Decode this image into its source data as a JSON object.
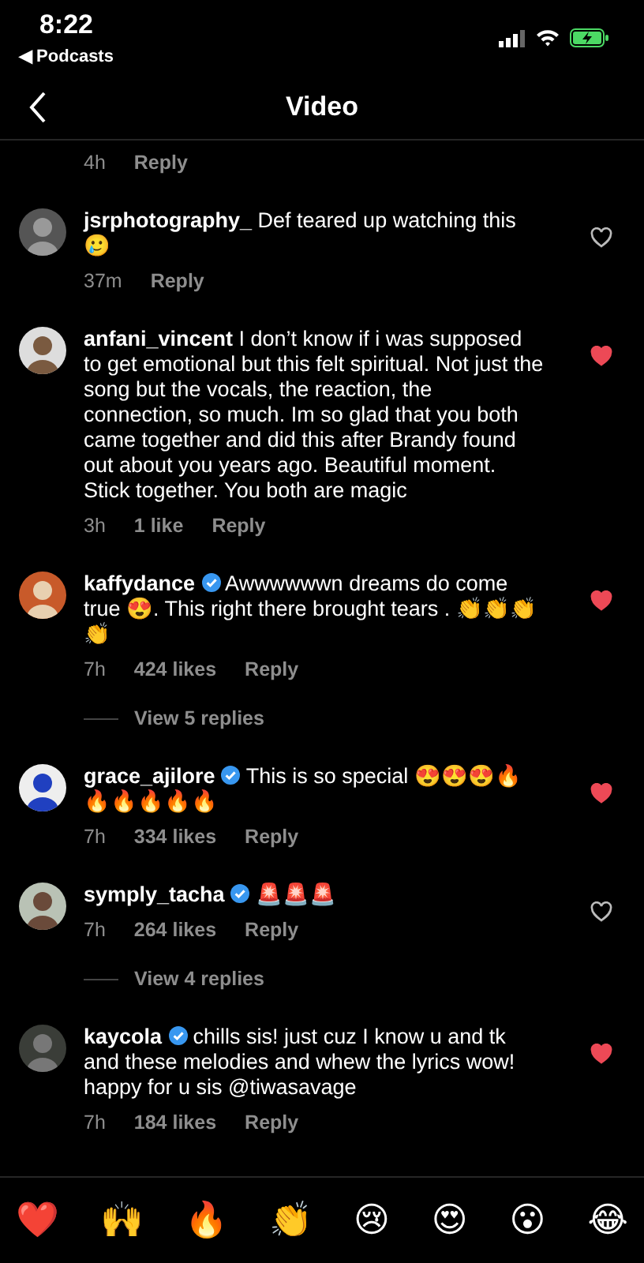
{
  "status_bar": {
    "time": "8:22",
    "back_app": "◀ Podcasts"
  },
  "nav": {
    "title": "Video"
  },
  "previous_comment": {
    "time": "4h",
    "reply": "Reply"
  },
  "comments": [
    {
      "user": "jsrphotography_",
      "verified": false,
      "text": "Def teared up watching this 🥲",
      "time": "37m",
      "reply": "Reply",
      "liked": false
    },
    {
      "user": "anfani_vincent",
      "verified": false,
      "text": "I don’t know if i was supposed to get emotional but this felt spiritual. Not just the song but the vocals, the reaction, the connection, so much. Im so glad that you both came together and did this after Brandy found out about you years ago. Beautiful moment. Stick together. You both are magic",
      "time": "3h",
      "likes": "1 like",
      "reply": "Reply",
      "liked": true
    },
    {
      "user": "kaffydance",
      "verified": true,
      "text": "Awwwwwwn dreams do come true 😍. This right there brought tears . 👏👏👏👏",
      "time": "7h",
      "likes": "424 likes",
      "reply": "Reply",
      "liked": true,
      "view_replies": "View 5 replies"
    },
    {
      "user": "grace_ajilore",
      "verified": true,
      "text": "This is so special 😍😍😍🔥🔥🔥🔥🔥🔥",
      "time": "7h",
      "likes": "334 likes",
      "reply": "Reply",
      "liked": true
    },
    {
      "user": "symply_tacha",
      "verified": true,
      "text": "🚨🚨🚨",
      "time": "7h",
      "likes": "264 likes",
      "reply": "Reply",
      "liked": false,
      "view_replies": "View 4 replies"
    },
    {
      "user": "kaycola",
      "verified": true,
      "text": "chills sis! just cuz I know u and tk and these melodies and whew the lyrics wow! happy for u sis @tiwasavage",
      "time": "7h",
      "likes": "184 likes",
      "reply": "Reply",
      "liked": true
    }
  ],
  "emoji_bar": [
    "❤️",
    "🙌",
    "🔥",
    "👏",
    "😢",
    "😍",
    "😮",
    "😂"
  ]
}
